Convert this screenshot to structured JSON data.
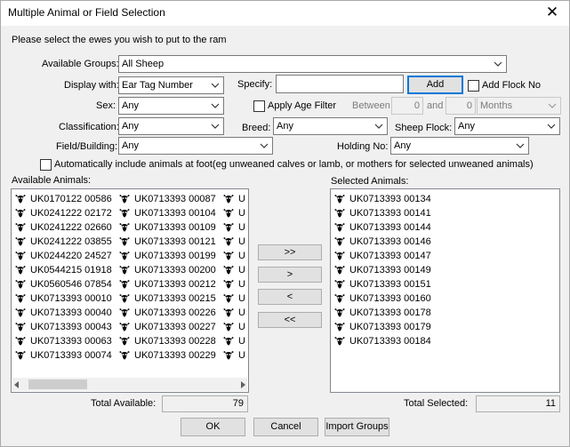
{
  "window": {
    "title": "Multiple Animal or Field Selection",
    "close_glyph": "✕"
  },
  "instruction": "Please select the ewes you wish to put to the ram",
  "labels": {
    "available_groups": "Available Groups:",
    "display_with": "Display with:",
    "specify": "Specify:",
    "sex": "Sex:",
    "classification": "Classification:",
    "breed": "Breed:",
    "sheep_flock": "Sheep Flock:",
    "field_building": "Field/Building:",
    "holding_no": "Holding No:",
    "between": "Between",
    "and": "and",
    "available_animals": "Available Animals:",
    "selected_animals": "Selected Animals:",
    "total_available": "Total Available:",
    "total_selected": "Total Selected:"
  },
  "fields": {
    "available_groups": "All Sheep",
    "display_with": "Ear Tag Number",
    "specify": "",
    "sex": "Any",
    "classification": "Any",
    "breed": "Any",
    "sheep_flock": "Any",
    "field_building": "Any",
    "holding_no": "Any",
    "between_from": "0",
    "between_to": "0",
    "period_unit": "Months"
  },
  "checkboxes": {
    "add_flock_no": {
      "label": "Add Flock No",
      "checked": false
    },
    "apply_age_filter": {
      "label": "Apply Age Filter",
      "checked": false
    },
    "include_at_foot": {
      "label": "Automatically include animals at foot(eg unweaned calves or lamb, or mothers for selected unweaned animals)",
      "checked": false
    }
  },
  "buttons": {
    "add": "Add",
    "move_all_right": ">>",
    "move_right": ">",
    "move_left": "<",
    "move_all_left": "<<",
    "ok": "OK",
    "cancel": "Cancel",
    "import_groups": "Import Groups"
  },
  "available_columns": [
    [
      "UK0170122 00586",
      "UK0241222 02172",
      "UK0241222 02660",
      "UK0241222 03855",
      "UK0244220 24527",
      "UK0544215 01918",
      "UK0560546 07854",
      "UK0713393 00010",
      "UK0713393 00040",
      "UK0713393 00043",
      "UK0713393 00063",
      "UK0713393 00074"
    ],
    [
      "UK0713393 00087",
      "UK0713393 00104",
      "UK0713393 00109",
      "UK0713393 00121",
      "UK0713393 00199",
      "UK0713393 00200",
      "UK0713393 00212",
      "UK0713393 00215",
      "UK0713393 00226",
      "UK0713393 00227",
      "UK0713393 00228",
      "UK0713393 00229"
    ],
    [
      "U",
      "U",
      "U",
      "U",
      "U",
      "U",
      "U",
      "U",
      "U",
      "U",
      "U",
      "U"
    ]
  ],
  "selected_animals": [
    "UK0713393 00134",
    "UK0713393 00141",
    "UK0713393 00144",
    "UK0713393 00146",
    "UK0713393 00147",
    "UK0713393 00149",
    "UK0713393 00151",
    "UK0713393 00160",
    "UK0713393 00178",
    "UK0713393 00179",
    "UK0713393 00184"
  ],
  "totals": {
    "available": "79",
    "selected": "11"
  },
  "icons": {
    "animal": "sheep-head-icon",
    "dropdown": "chevron-down-icon"
  }
}
